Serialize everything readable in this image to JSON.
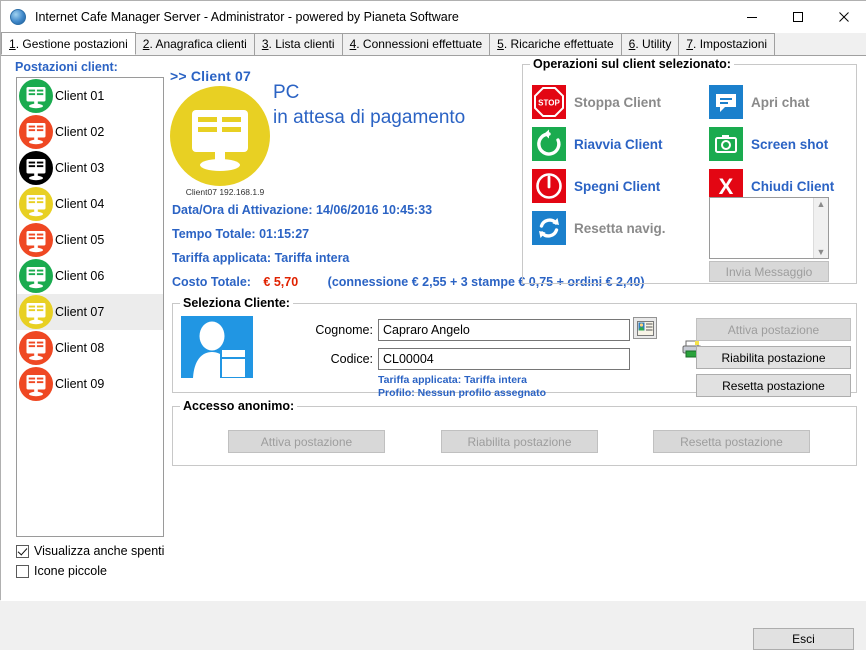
{
  "window": {
    "title": "Internet Cafe Manager Server - Administrator - powered by Pianeta Software",
    "app_icon": "globe-icon",
    "minimize": "minimize-icon",
    "maximize": "maximize-icon",
    "close": "close-icon"
  },
  "tabs": [
    {
      "num": "1",
      "label": ". Gestione postazioni",
      "active": true
    },
    {
      "num": "2",
      "label": ". Anagrafica clienti",
      "active": false
    },
    {
      "num": "3",
      "label": ". Lista clienti",
      "active": false
    },
    {
      "num": "4",
      "label": ". Connessioni effettuate",
      "active": false
    },
    {
      "num": "5",
      "label": ". Ricariche effettuate",
      "active": false
    },
    {
      "num": "6",
      "label": ". Utility",
      "active": false
    },
    {
      "num": "7",
      "label": ". Impostazioni",
      "active": false
    }
  ],
  "sidebar": {
    "title": "Postazioni client:",
    "clients": [
      {
        "label": "Client 01",
        "color": "#1aab4f",
        "selected": false
      },
      {
        "label": "Client 02",
        "color": "#ef4823",
        "selected": false
      },
      {
        "label": "Client 03",
        "color": "#000000",
        "selected": false
      },
      {
        "label": "Client 04",
        "color": "#e8d023",
        "selected": false
      },
      {
        "label": "Client 05",
        "color": "#ef4823",
        "selected": false
      },
      {
        "label": "Client 06",
        "color": "#1aab4f",
        "selected": false
      },
      {
        "label": "Client 07",
        "color": "#e8d023",
        "selected": true
      },
      {
        "label": "Client 08",
        "color": "#ef4823",
        "selected": false
      },
      {
        "label": "Client 09",
        "color": "#ef4823",
        "selected": false
      }
    ],
    "checkbox_show_off": {
      "label": "Visualizza anche spenti",
      "checked": true
    },
    "checkbox_small_icons": {
      "label": "Icone piccole",
      "checked": false
    }
  },
  "selected_client": {
    "heading": ">> Client 07",
    "icon_color": "#e8d023",
    "icon_caption": "Client07 192.168.1.9",
    "status_line1": "PC",
    "status_line2": "in attesa di pagamento",
    "activation_label": "Data/Ora di Attivazione:",
    "activation_value": "14/06/2016 10:45:33",
    "total_time_label": "Tempo Totale:",
    "total_time_value": "01:15:27",
    "tariff_label": "Tariffa applicata:",
    "tariff_value": "Tariffa intera",
    "cost_label": "Costo Totale:",
    "cost_value": "€ 5,70",
    "cost_breakdown": "(connessione € 2,55 + 3 stampe € 0,75 + ordini € 2,40)",
    "print_icon": "printer-icon"
  },
  "operations": {
    "title": "Operazioni sul client selezionato:",
    "items": [
      {
        "label": "Stoppa Client",
        "icon": "stop-sign-icon",
        "bg": "#e30613",
        "enabled": false
      },
      {
        "label": "Apri chat",
        "icon": "chat-bubble-icon",
        "bg": "#1b80cc",
        "enabled": false
      },
      {
        "label": "Riavvia Client",
        "icon": "restart-arrow-icon",
        "bg": "#1aab4f",
        "enabled": true
      },
      {
        "label": "Screen shot",
        "icon": "camera-icon",
        "bg": "#1aab4f",
        "enabled": true
      },
      {
        "label": "Spegni Client",
        "icon": "power-icon",
        "bg": "#e30613",
        "enabled": true
      },
      {
        "label": "Chiudi Client",
        "icon": "x-mark-icon",
        "bg": "#e30613",
        "enabled": true
      },
      {
        "label": "Resetta navig.",
        "icon": "refresh-cycle-icon",
        "bg": "#1b80cc",
        "enabled": false
      }
    ],
    "message_textarea_value": "",
    "send_message_label": "Invia Messaggio",
    "send_message_enabled": false,
    "scroll_up": "chevron-up-icon",
    "scroll_down": "chevron-down-icon"
  },
  "select_client": {
    "title": "Seleziona Cliente:",
    "avatar_icon": "user-card-icon",
    "surname_label": "Cognome:",
    "surname_value": "Capraro Angelo",
    "code_label": "Codice:",
    "code_value": "CL00004",
    "card_button_icon": "contact-card-icon",
    "tariff_info": "Tariffa applicata: Tariffa intera",
    "profile_info": "Profilo: Nessun profilo assegnato",
    "buttons": [
      {
        "label": "Attiva postazione",
        "enabled": false
      },
      {
        "label": "Riabilita postazione",
        "enabled": true
      },
      {
        "label": "Resetta postazione",
        "enabled": true
      }
    ]
  },
  "anonymous_access": {
    "title": "Accesso anonimo:",
    "buttons": [
      {
        "label": "Attiva postazione",
        "enabled": false
      },
      {
        "label": "Riabilita postazione",
        "enabled": false
      },
      {
        "label": "Resetta postazione",
        "enabled": false
      }
    ]
  },
  "footer": {
    "exit_label": "Esci"
  }
}
